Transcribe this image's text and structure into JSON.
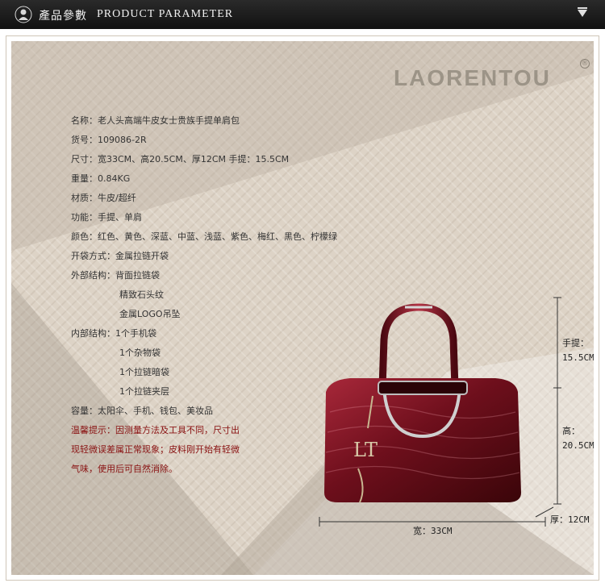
{
  "header": {
    "title_cn": "產品參數",
    "title_en": "PRODUCT PARAMETER"
  },
  "brand": {
    "name": "LAORENTOU",
    "registered": "®"
  },
  "specs": {
    "name": "名称：老人头高端牛皮女士贵族手提单肩包",
    "item_no": "货号：109086-2R",
    "size": "尺寸：宽33CM、高20.5CM、厚12CM  手提：15.5CM",
    "weight": "重量：0.84KG",
    "material": "材质：牛皮/超纤",
    "function": "功能：手提、单肩",
    "colors": "颜色：红色、黄色、深蓝、中蓝、浅蓝、紫色、梅红、黑色、柠檬绿",
    "opening": "开袋方式：金属拉链开袋",
    "outer_label": "外部结构：背面拉链袋",
    "outer_2": "精致石头纹",
    "outer_3": "金属LOGO吊坠",
    "inner_label": "内部结构：1个手机袋",
    "inner_2": "1个杂物袋",
    "inner_3": "1个拉链暗袋",
    "inner_4": "1个拉链夹层",
    "capacity": "容量：太阳伞、手机、钱包、美妆品",
    "warning_1": "温馨提示：因测量方法及工具不同，尺寸出",
    "warning_2": "现轻微误差属正常现象；皮料刚开始有轻微",
    "warning_3": "气味，使用后可自然消除。"
  },
  "dimensions": {
    "handle_label": "手提：",
    "handle_value": "15.5CM",
    "height_label": "高：",
    "height_value": "20.5CM",
    "depth": "厚：12CM",
    "width": "宽：33CM"
  },
  "colors": {
    "header_bg": "#1a1a1a",
    "panel_bg": "#ddd3c6",
    "bag_main": "#6e0f1c",
    "warning_text": "#8a1212"
  }
}
